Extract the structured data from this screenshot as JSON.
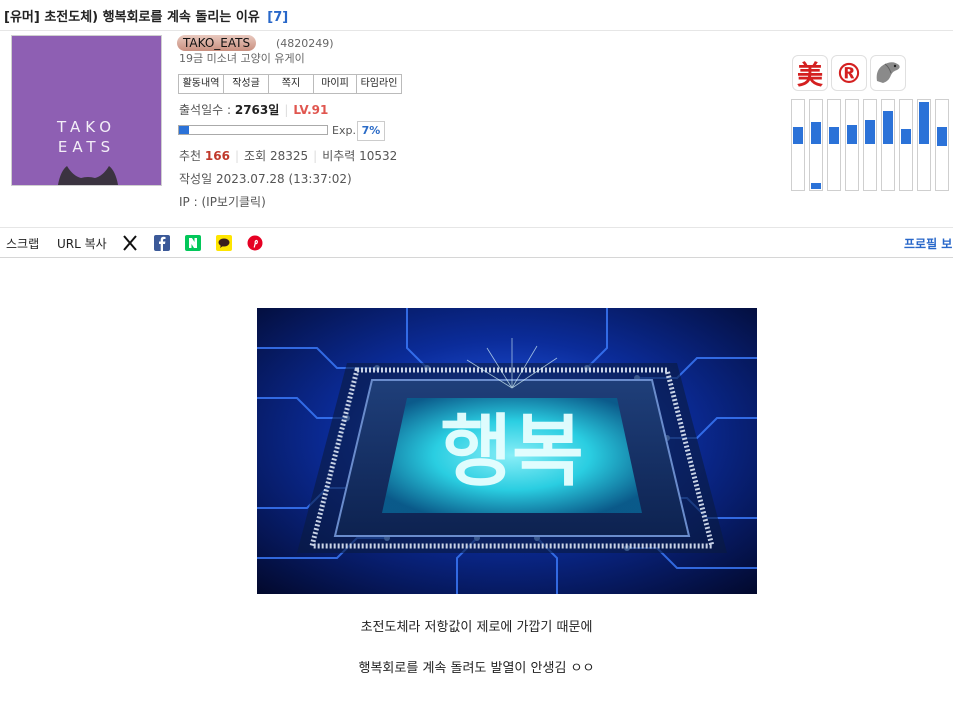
{
  "post": {
    "category": "[유머]",
    "title": "초전도체) 행복회로를 계속 돌리는 이유",
    "comment_count": "[7]",
    "image_text": "행복",
    "body_lines": [
      "초전도체라 저항값이 제로에 가깝기 때문에",
      "행복회로를 계속 돌려도 발열이 안생김 ㅇㅇ"
    ]
  },
  "author": {
    "avatar_lines": [
      "TAKO",
      "EATS"
    ],
    "nickname": "TAKO_EATS",
    "user_no": "(4820249)",
    "description": "19금 미소녀 고양이 유게이",
    "actions": [
      "활동내역",
      "작성글",
      "쪽지",
      "마이피",
      "타임라인"
    ],
    "attendance_label": "출석일수 :",
    "attendance_value": "2763일",
    "level": "LV.91",
    "exp_label": "Exp.",
    "exp_percent": "7%",
    "exp_fraction": 0.07
  },
  "stats": {
    "recommend_label": "추천",
    "recommend_value": "166",
    "views_label": "조회",
    "views_value": "28325",
    "nonrec_label": "비추력",
    "nonrec_value": "10532",
    "written_label": "작성일",
    "written_value": "2023.07.28 (13:37:02)",
    "ip_label": "IP :",
    "ip_value": "(IP보기클릭)"
  },
  "badges": {
    "beauty": "美",
    "registered": "®"
  },
  "share": {
    "scrap": "스크랩",
    "url_copy": "URL 복사",
    "profile": "프로필 보"
  },
  "colors": {
    "accent_blue": "#2b72d8",
    "level_red": "#e0564f",
    "avatar_purple": "#8e5fb3"
  }
}
